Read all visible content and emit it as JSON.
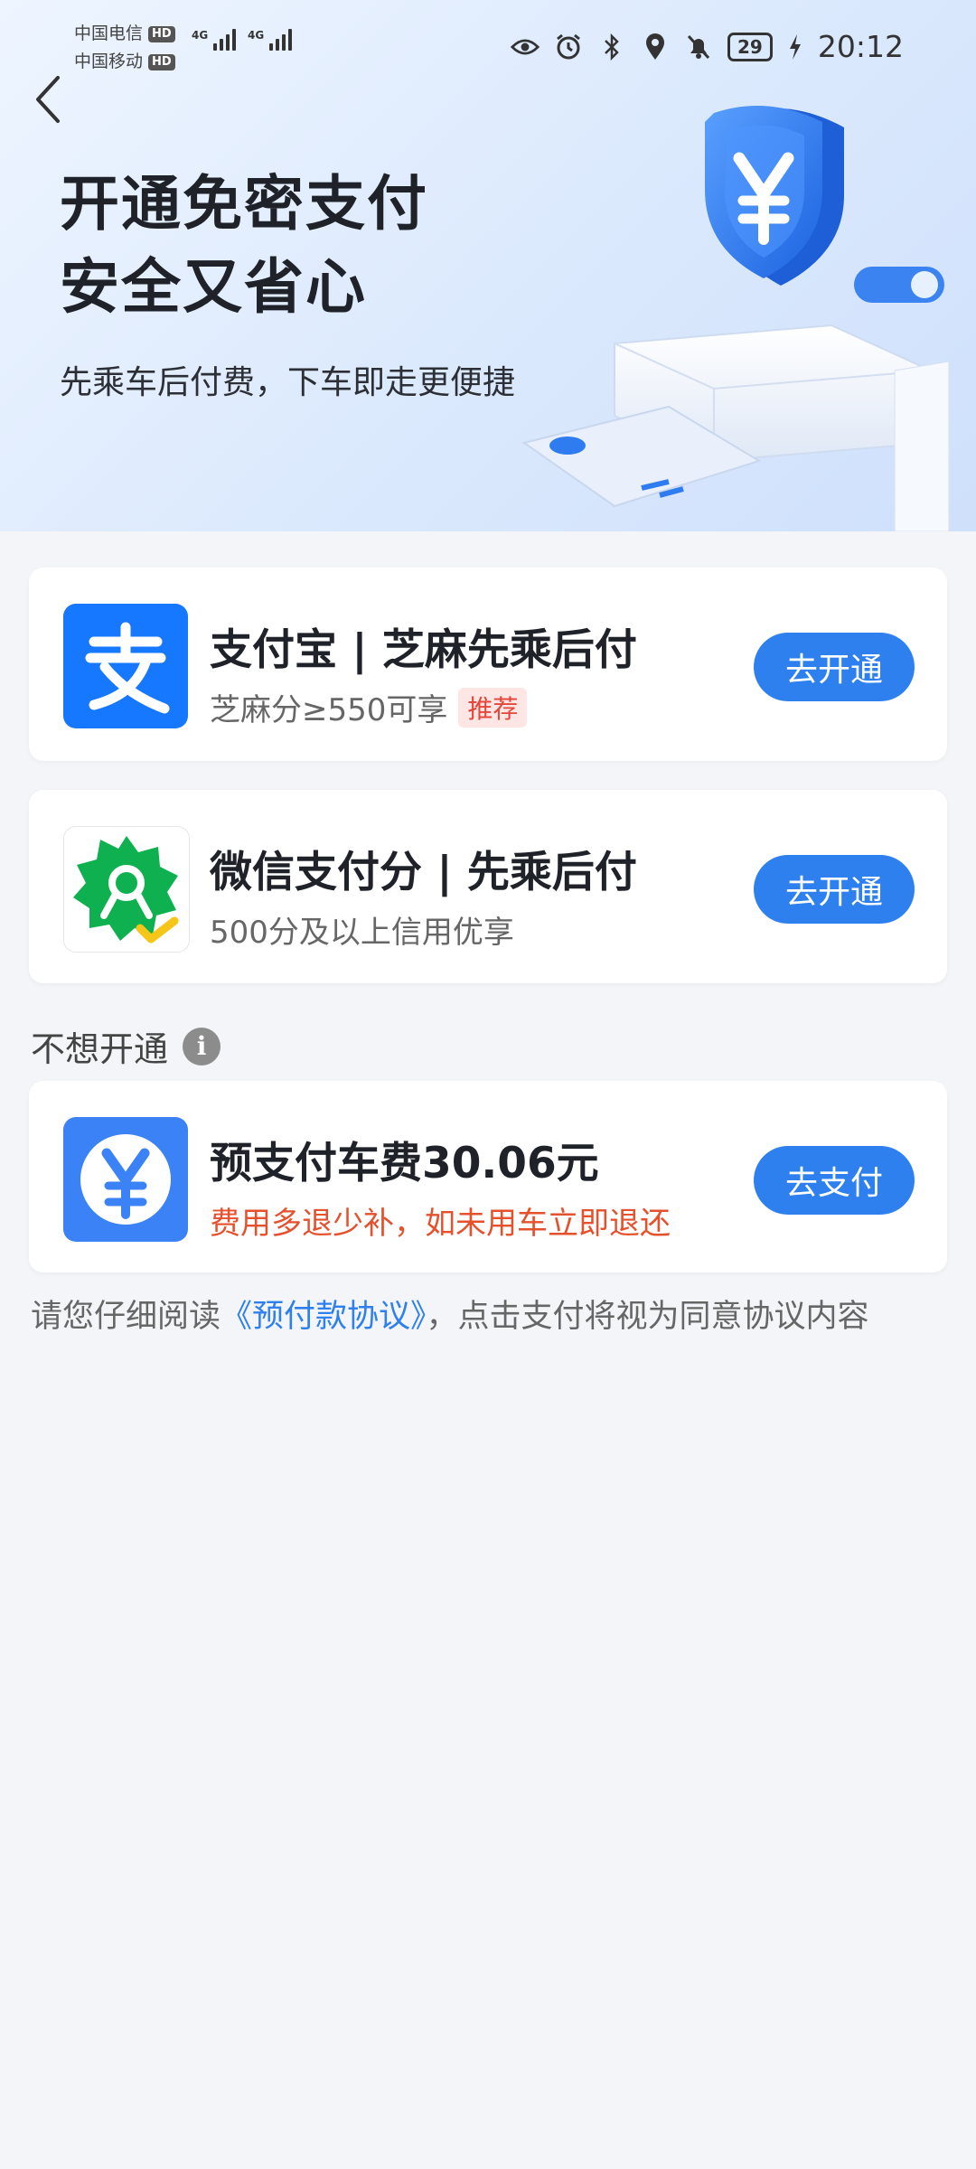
{
  "status_bar": {
    "carrier1": "中国电信",
    "carrier2": "中国移动",
    "hd_label": "HD",
    "network_label": "4G",
    "battery": "29",
    "time": "20:12"
  },
  "hero": {
    "title_line1": "开通免密支付",
    "title_line2": "安全又省心",
    "subtitle": "先乘车后付费，下车即走更便捷"
  },
  "options": [
    {
      "title": "支付宝 | 芝麻先乘后付",
      "desc": "芝麻分≥550可享",
      "tag": "推荐",
      "button": "去开通"
    },
    {
      "title": "微信支付分 | 先乘后付",
      "desc": "500分及以上信用优享",
      "button": "去开通"
    }
  ],
  "section": {
    "label": "不想开通",
    "info_glyph": "i"
  },
  "prepay": {
    "title": "预支付车费30.06元",
    "desc": "费用多退少补，如未用车立即退还",
    "button": "去支付"
  },
  "agreement": {
    "prefix": "请您仔细阅读",
    "link": "《预付款协议》",
    "suffix": "，点击支付将视为同意协议内容"
  },
  "colors": {
    "accent": "#2f80ef",
    "alipay": "#1677ff",
    "wechat_green": "#07c160",
    "warning": "#e4512c"
  }
}
